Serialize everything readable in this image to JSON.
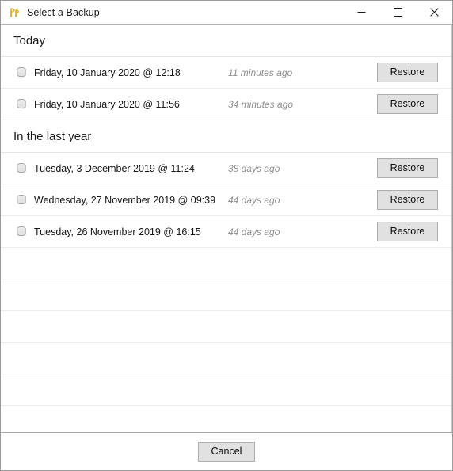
{
  "window": {
    "title": "Select a Backup",
    "app_icon": "app-logo-icon",
    "icon_color": "#f0b323",
    "controls": [
      {
        "name": "minimize",
        "glyph": "minimize-icon"
      },
      {
        "name": "maximize",
        "glyph": "maximize-icon"
      },
      {
        "name": "close",
        "glyph": "close-icon"
      }
    ]
  },
  "list": {
    "row_icon": "database-icon",
    "restore_label": "Restore",
    "sections": [
      {
        "header": "Today",
        "rows": [
          {
            "label": "Friday, 10 January 2020 @ 12:18",
            "relative": "11 minutes ago"
          },
          {
            "label": "Friday, 10 January 2020 @ 11:56",
            "relative": "34 minutes ago"
          }
        ]
      },
      {
        "header": "In the last year",
        "rows": [
          {
            "label": "Tuesday, 3 December 2019 @ 11:24",
            "relative": "38 days ago"
          },
          {
            "label": "Wednesday, 27 November 2019 @ 09:39",
            "relative": "44 days ago"
          },
          {
            "label": "Tuesday, 26 November 2019 @ 16:15",
            "relative": "44 days ago"
          }
        ]
      }
    ],
    "empty_row_count": 6
  },
  "footer": {
    "cancel_label": "Cancel"
  },
  "colors": {
    "accent": "#f0b323",
    "row_separator": "#ececec",
    "button_face": "#e1e1e1",
    "button_border": "#adadad",
    "muted_text": "#8d8d8d"
  }
}
